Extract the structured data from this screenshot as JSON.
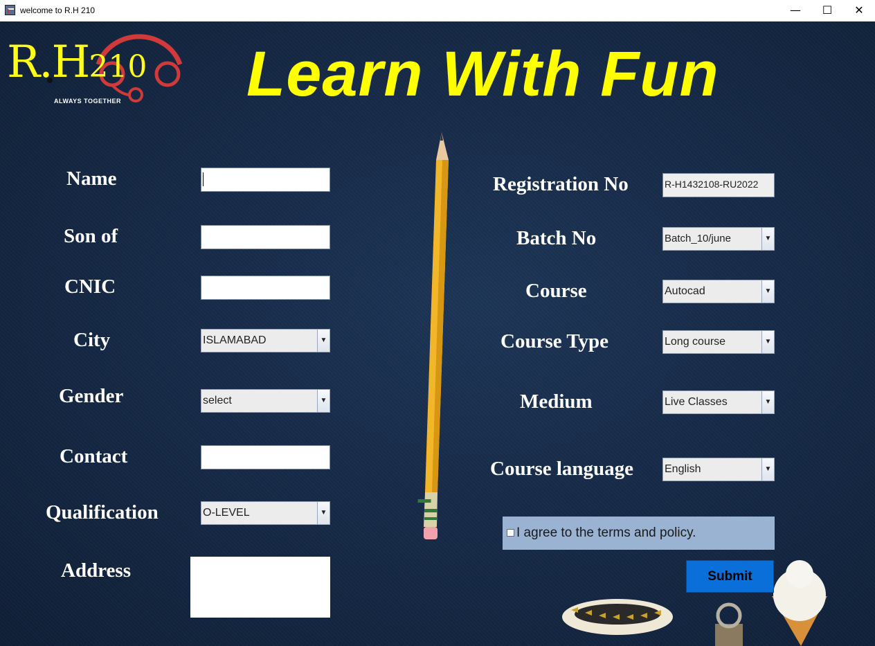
{
  "window": {
    "title": "welcome to R.H 210",
    "min": "—",
    "max": "☐",
    "close": "✕"
  },
  "logo": {
    "text": "R.H",
    "number": "210",
    "tagline": "ALWAYS TOGETHER"
  },
  "headline": "Learn With Fun",
  "form_left": {
    "name_label": "Name",
    "sonof_label": "Son of",
    "cnic_label": "CNIC",
    "city_label": "City",
    "city_value": "ISLAMABAD",
    "gender_label": "Gender",
    "gender_value": "select",
    "contact_label": "Contact",
    "qualification_label": "Qualification",
    "qualification_value": "O-LEVEL",
    "address_label": "Address"
  },
  "form_right": {
    "reg_label": "Registration No",
    "reg_value": "R-H1432108-RU2022",
    "batch_label": "Batch No",
    "batch_value": "Batch_10/june",
    "course_label": "Course",
    "course_value": "Autocad",
    "coursetype_label": "Course Type",
    "coursetype_value": "Long course",
    "medium_label": "Medium",
    "medium_value": "Live Classes",
    "language_label": "Course language",
    "language_value": "English"
  },
  "agree_text": "I agree to the terms and policy.",
  "submit_label": "Submit",
  "icons": {
    "dropdown": "chevron-down-icon"
  },
  "colors": {
    "headline": "#ffff00",
    "background": "#162a47",
    "submit": "#0a6fd8",
    "agree_panel": "#9bb3d3"
  }
}
